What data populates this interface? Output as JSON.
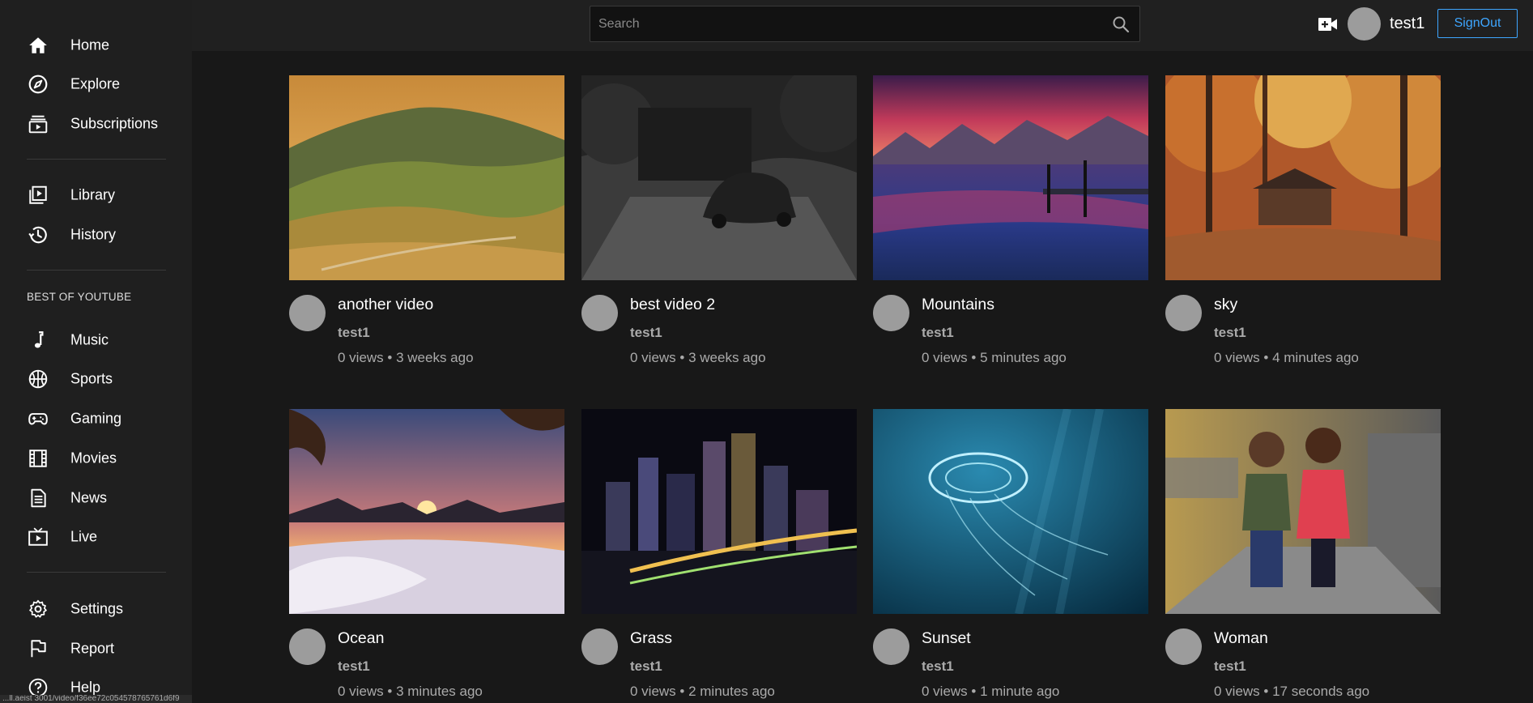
{
  "sidebar": {
    "primary": [
      {
        "label": "Home",
        "icon": "home-icon"
      },
      {
        "label": "Explore",
        "icon": "compass-icon"
      },
      {
        "label": "Subscriptions",
        "icon": "subscriptions-icon"
      }
    ],
    "library": [
      {
        "label": "Library",
        "icon": "library-icon"
      },
      {
        "label": "History",
        "icon": "history-icon"
      }
    ],
    "section_title": "BEST OF YOUTUBE",
    "best_of": [
      {
        "label": "Music",
        "icon": "music-note-icon"
      },
      {
        "label": "Sports",
        "icon": "basketball-icon"
      },
      {
        "label": "Gaming",
        "icon": "gamepad-icon"
      },
      {
        "label": "Movies",
        "icon": "film-icon"
      },
      {
        "label": "News",
        "icon": "newspaper-icon"
      },
      {
        "label": "Live",
        "icon": "live-tv-icon"
      }
    ],
    "footer": [
      {
        "label": "Settings",
        "icon": "gear-icon"
      },
      {
        "label": "Report",
        "icon": "flag-icon"
      },
      {
        "label": "Help",
        "icon": "help-icon"
      }
    ],
    "status_url": "...ll.aeist 3001/video/f36ee72c054578765761d6f9"
  },
  "header": {
    "search_placeholder": "Search",
    "username": "test1",
    "signout_label": "SignOut"
  },
  "videos": [
    {
      "title": "another video",
      "channel": "test1",
      "meta": "0 views • 3 weeks ago",
      "thumb": "vineyard-hills"
    },
    {
      "title": "best video 2",
      "channel": "test1",
      "meta": "0 views • 3 weeks ago",
      "thumb": "car-driveway"
    },
    {
      "title": "Mountains",
      "channel": "test1",
      "meta": "0 views • 5 minutes ago",
      "thumb": "mountain-lake"
    },
    {
      "title": "sky",
      "channel": "test1",
      "meta": "0 views • 4 minutes ago",
      "thumb": "autumn-cabin"
    },
    {
      "title": "Ocean",
      "channel": "test1",
      "meta": "0 views • 3 minutes ago",
      "thumb": "snow-sunset"
    },
    {
      "title": "Grass",
      "channel": "test1",
      "meta": "0 views • 2 minutes ago",
      "thumb": "city-night"
    },
    {
      "title": "Sunset",
      "channel": "test1",
      "meta": "0 views • 1 minute ago",
      "thumb": "jellyfish"
    },
    {
      "title": "Woman",
      "channel": "test1",
      "meta": "0 views • 17 seconds ago",
      "thumb": "children-path"
    }
  ]
}
